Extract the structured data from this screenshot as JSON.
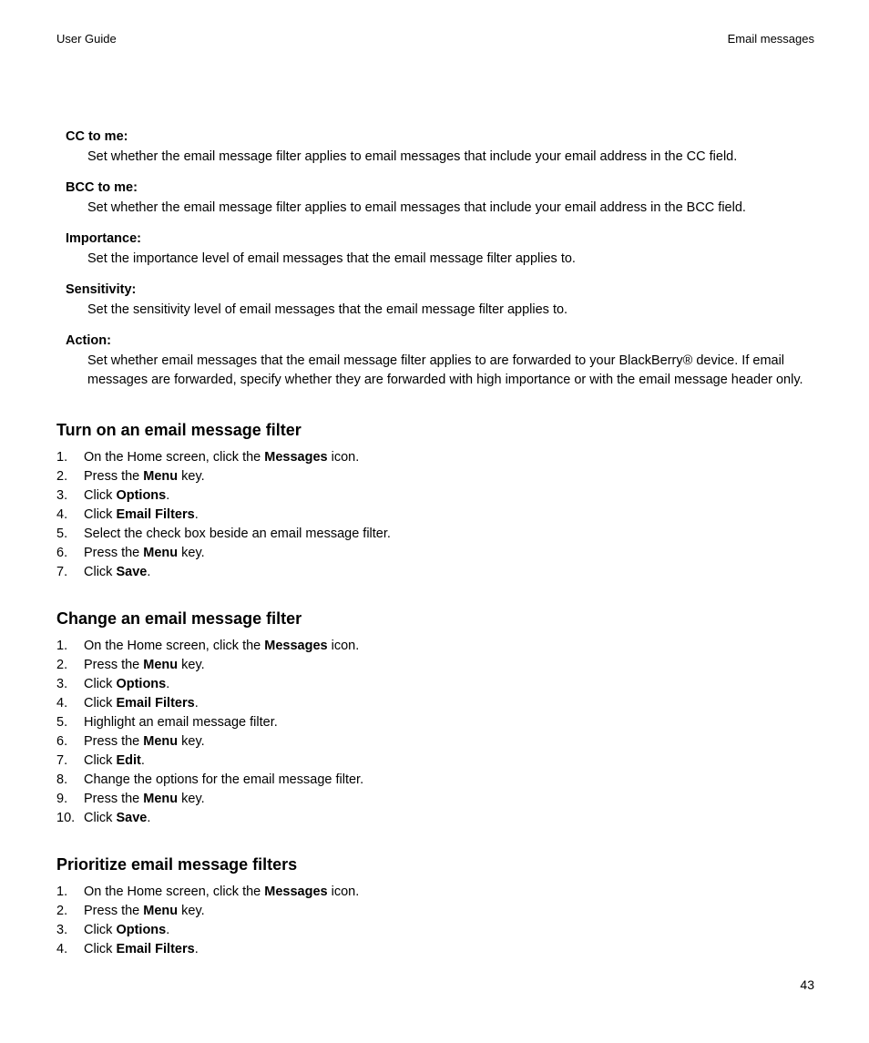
{
  "header": {
    "left": "User Guide",
    "right": "Email messages"
  },
  "definitions": [
    {
      "term": "CC to me:",
      "desc": "Set whether the email message filter applies to email messages that include your email address in the CC field."
    },
    {
      "term": "BCC to me:",
      "desc": "Set whether the email message filter applies to email messages that include your email address in the BCC field."
    },
    {
      "term": "Importance:",
      "desc": "Set the importance level of email messages that the email message filter applies to."
    },
    {
      "term": "Sensitivity:",
      "desc": "Set the sensitivity level of email messages that the email message filter applies to."
    },
    {
      "term": "Action:",
      "desc": "Set whether email messages that the email message filter applies to are forwarded to your BlackBerry® device. If email messages are forwarded, specify whether they are forwarded with high importance or with the email message header only."
    }
  ],
  "sections": [
    {
      "heading": "Turn on an email message filter",
      "steps": [
        [
          {
            "t": "On the Home screen, click the "
          },
          {
            "b": "Messages"
          },
          {
            "t": " icon."
          }
        ],
        [
          {
            "t": "Press the "
          },
          {
            "b": "Menu"
          },
          {
            "t": " key."
          }
        ],
        [
          {
            "t": "Click "
          },
          {
            "b": "Options"
          },
          {
            "t": "."
          }
        ],
        [
          {
            "t": "Click "
          },
          {
            "b": "Email Filters"
          },
          {
            "t": "."
          }
        ],
        [
          {
            "t": "Select the check box beside an email message filter."
          }
        ],
        [
          {
            "t": "Press the "
          },
          {
            "b": "Menu"
          },
          {
            "t": " key."
          }
        ],
        [
          {
            "t": "Click "
          },
          {
            "b": "Save"
          },
          {
            "t": "."
          }
        ]
      ]
    },
    {
      "heading": "Change an email message filter",
      "steps": [
        [
          {
            "t": "On the Home screen, click the "
          },
          {
            "b": "Messages"
          },
          {
            "t": " icon."
          }
        ],
        [
          {
            "t": "Press the "
          },
          {
            "b": "Menu"
          },
          {
            "t": " key."
          }
        ],
        [
          {
            "t": "Click "
          },
          {
            "b": "Options"
          },
          {
            "t": "."
          }
        ],
        [
          {
            "t": "Click "
          },
          {
            "b": "Email Filters"
          },
          {
            "t": "."
          }
        ],
        [
          {
            "t": "Highlight an email message filter."
          }
        ],
        [
          {
            "t": "Press the "
          },
          {
            "b": "Menu"
          },
          {
            "t": " key."
          }
        ],
        [
          {
            "t": "Click "
          },
          {
            "b": "Edit"
          },
          {
            "t": "."
          }
        ],
        [
          {
            "t": "Change the options for the email message filter."
          }
        ],
        [
          {
            "t": "Press the "
          },
          {
            "b": "Menu"
          },
          {
            "t": " key."
          }
        ],
        [
          {
            "t": "Click "
          },
          {
            "b": "Save"
          },
          {
            "t": "."
          }
        ]
      ]
    },
    {
      "heading": "Prioritize email message filters",
      "steps": [
        [
          {
            "t": "On the Home screen, click the "
          },
          {
            "b": "Messages"
          },
          {
            "t": " icon."
          }
        ],
        [
          {
            "t": "Press the "
          },
          {
            "b": "Menu"
          },
          {
            "t": " key."
          }
        ],
        [
          {
            "t": "Click "
          },
          {
            "b": "Options"
          },
          {
            "t": "."
          }
        ],
        [
          {
            "t": "Click "
          },
          {
            "b": "Email Filters"
          },
          {
            "t": "."
          }
        ]
      ]
    }
  ],
  "page_number": "43"
}
